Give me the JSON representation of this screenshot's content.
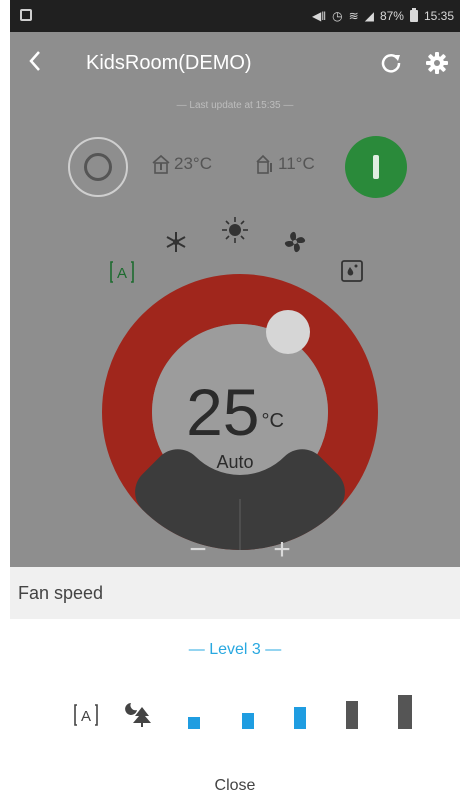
{
  "status_bar": {
    "battery_percent": "87%",
    "time": "15:35",
    "icons": [
      "mute-icon",
      "alarm-icon",
      "wifi-icon",
      "signal-icon",
      "battery-icon"
    ]
  },
  "toolbar": {
    "back_icon": "chevron-left-icon",
    "title": "KidsRoom(DEMO)",
    "refresh_icon": "refresh-icon",
    "settings_icon": "gear-icon"
  },
  "last_update": "— Last update at 15:35 —",
  "info": {
    "indoor_temp": "23°C",
    "outdoor_temp": "11°C"
  },
  "modes": [
    "cool",
    "heat",
    "fan",
    "auto",
    "dry"
  ],
  "dial": {
    "temperature": "25",
    "unit": "°C",
    "mode_label": "Auto",
    "minus_label": "−",
    "plus_label": "+",
    "colors": {
      "ring": "#a0261c",
      "controls": "#3c3c3c",
      "power": "#2a8a3a"
    }
  },
  "fan_sheet": {
    "title": "Fan speed",
    "level_label": "— Level 3 —",
    "speeds": [
      {
        "name": "auto"
      },
      {
        "name": "silent"
      },
      {
        "name": "level-1",
        "active": true
      },
      {
        "name": "level-2",
        "active": true
      },
      {
        "name": "level-3",
        "active": true
      },
      {
        "name": "level-4",
        "active": false
      },
      {
        "name": "level-5",
        "active": false
      }
    ],
    "active_color": "#1f9de1",
    "inactive_color": "#555555",
    "close_label": "Close"
  }
}
